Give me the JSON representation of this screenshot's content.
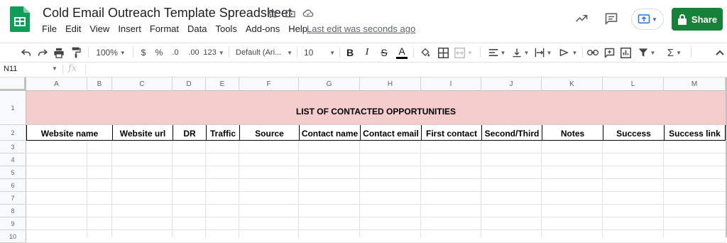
{
  "doc": {
    "title": "Cold Email Outreach Template Spreadsheet",
    "last_edit": "Last edit was seconds ago"
  },
  "menu": [
    "File",
    "Edit",
    "View",
    "Insert",
    "Format",
    "Data",
    "Tools",
    "Add-ons",
    "Help"
  ],
  "toolbar": {
    "zoom": "100%",
    "currency": "$",
    "percent": "%",
    "decrease_decimal": ".0",
    "increase_decimal": ".00",
    "more_formats": "123",
    "font": "Default (Ari...",
    "font_size": "10",
    "bold": "B",
    "italic": "I",
    "strike": "S",
    "text_color": "A"
  },
  "share": {
    "label": "Share"
  },
  "formula_bar": {
    "cell_ref": "N11",
    "fx": "fx"
  },
  "columns": [
    "A",
    "B",
    "C",
    "D",
    "E",
    "F",
    "G",
    "H",
    "I",
    "J",
    "K",
    "L",
    "M"
  ],
  "rows": [
    "1",
    "2",
    "3",
    "4",
    "5",
    "6",
    "7",
    "8",
    "9",
    "10"
  ],
  "sheet": {
    "banner": "LIST OF CONTACTED OPPORTUNITIES",
    "headers": [
      "Website name",
      "Website url",
      "DR",
      "Traffic",
      "Source",
      "Contact name",
      "Contact email",
      "First contact",
      "Second/Third",
      "Notes",
      "Success",
      "Success link"
    ]
  },
  "colors": {
    "banner_bg": "#f4cccc",
    "share_bg": "#188038",
    "sheets_green": "#0f9d58"
  }
}
